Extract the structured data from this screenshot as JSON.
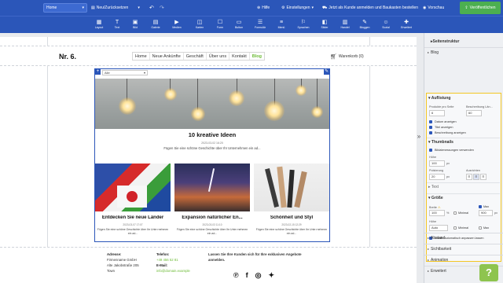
{
  "topbar": {
    "page_select": "Home",
    "new_page": "Neu/Zurücksetzen",
    "help": "Hilfe",
    "settings": "Einstellungen",
    "customer_login": "Jetzt als Kunde anmelden und Baukasten bestellen",
    "preview": "Vorschau",
    "publish": "Veröffentlichen"
  },
  "iconbar": [
    {
      "label": "Layout",
      "icon": "layout-icon",
      "glyph": "▦"
    },
    {
      "label": "Text",
      "icon": "text-icon",
      "glyph": "T"
    },
    {
      "label": "Bild",
      "icon": "image-icon",
      "glyph": "▣"
    },
    {
      "label": "Galerie",
      "icon": "gallery-icon",
      "glyph": "▤"
    },
    {
      "label": "Medien",
      "icon": "media-icon",
      "glyph": "▶"
    },
    {
      "label": "Karten",
      "icon": "map-icon",
      "glyph": "◫"
    },
    {
      "label": "Form",
      "icon": "form-icon",
      "glyph": "☐"
    },
    {
      "label": "Button",
      "icon": "button-icon",
      "glyph": "▭"
    },
    {
      "label": "Formulär",
      "icon": "form-builder-icon",
      "glyph": "☰"
    },
    {
      "label": "Menü",
      "icon": "menu-icon",
      "glyph": "≡"
    },
    {
      "label": "Sprachen",
      "icon": "languages-icon",
      "glyph": "⚐"
    },
    {
      "label": "Slider",
      "icon": "slider-icon",
      "glyph": "◧"
    },
    {
      "label": "Handel",
      "icon": "shop-icon",
      "glyph": "▥"
    },
    {
      "label": "Bloggen",
      "icon": "blog-icon",
      "glyph": "✎"
    },
    {
      "label": "Sozial",
      "icon": "social-icon",
      "glyph": "☺"
    },
    {
      "label": "Erweitert",
      "icon": "advanced-icon",
      "glyph": "✚"
    }
  ],
  "header": {
    "logo": "Nr. 6.",
    "nav": [
      "Home",
      "Neue Ankünfte",
      "Geschäft",
      "Über uns",
      "Kontakt",
      "Blog"
    ],
    "cart": "Warenkorb (0)"
  },
  "blog": {
    "selector": "Alle",
    "featured": {
      "title": "10 kreative Ideen",
      "date": "2023-03-02 16:20",
      "excerpt": "Fügen Sie eine schöne Geschichte über Ihr Unternehmen ein ad..."
    },
    "cards": [
      {
        "title": "Entdecken Sie neue Länder",
        "date": "2023-03-07 17:07",
        "excerpt": "Fügen Sie eine schöne Geschichte über Ihr Unte rnehmen ein ad..."
      },
      {
        "title": "Expansion natürlicher En...",
        "date": "2023-03-03 11:10",
        "excerpt": "Fügen Sie eine schöne Geschichte über Ihr Unte rnehmen ein ad..."
      },
      {
        "title": "Schönheit und Styl",
        "date": "2023-02-15 12:29",
        "excerpt": "Fügen Sie eine schöne Geschichte über Ihr Unte rnehmen ein ad..."
      }
    ]
  },
  "footer": {
    "address_label": "Adresse:",
    "address_lines": [
      "Firmenname GmbH",
      "Alte Jakobstraße 205",
      "Town"
    ],
    "phone_label": "Telefon:",
    "phone": "+49 456 52 81",
    "email_label": "E-Mail:",
    "email": "info@domain.example",
    "cta": "Lassen Sie Ihre Kunden sich für Ihre exklusiven Angebote anmelden.",
    "social": [
      "pinterest-icon",
      "facebook-icon",
      "instagram-icon",
      "twitter-icon"
    ]
  },
  "panel": {
    "structure": "Seitenstruktur",
    "blog": "Blog",
    "listing": "Auflistung",
    "products_per_page_label": "Produkte pro Seite",
    "products_per_page": "6",
    "desc_length_label": "Beschreibung Län...",
    "desc_length": "60",
    "show_date": "Datum anzeigen",
    "show_title": "Titel anzeigen",
    "show_description": "Beschreibung anzeigen",
    "thumbnails": "Thumbnails",
    "use_thumbnails": "Bildabmessungen verwenden",
    "height_label": "Höhe",
    "height": "100",
    "height_unit": "px",
    "padding_label": "Polsterung",
    "padding": "20",
    "padding_unit": "px",
    "alignment_label": "Ausrichten",
    "text_section": "Text",
    "size_section": "Größe",
    "width_label": "Breite",
    "width": "100",
    "width_unit": "%",
    "min_width_label": "Minimal",
    "max_label": "Max",
    "max_width": "900",
    "max_width_unit": "px",
    "height2_label": "Höhe",
    "height2": "Auto",
    "min_height_label": "Minimal",
    "max2_label": "Max",
    "auto_adjust": "Inhalte automatisch anpassen lassen",
    "collapsed": [
      "Abstand",
      "Sichtbarkeit",
      "Animation",
      "Erweitert"
    ],
    "help": "?"
  }
}
